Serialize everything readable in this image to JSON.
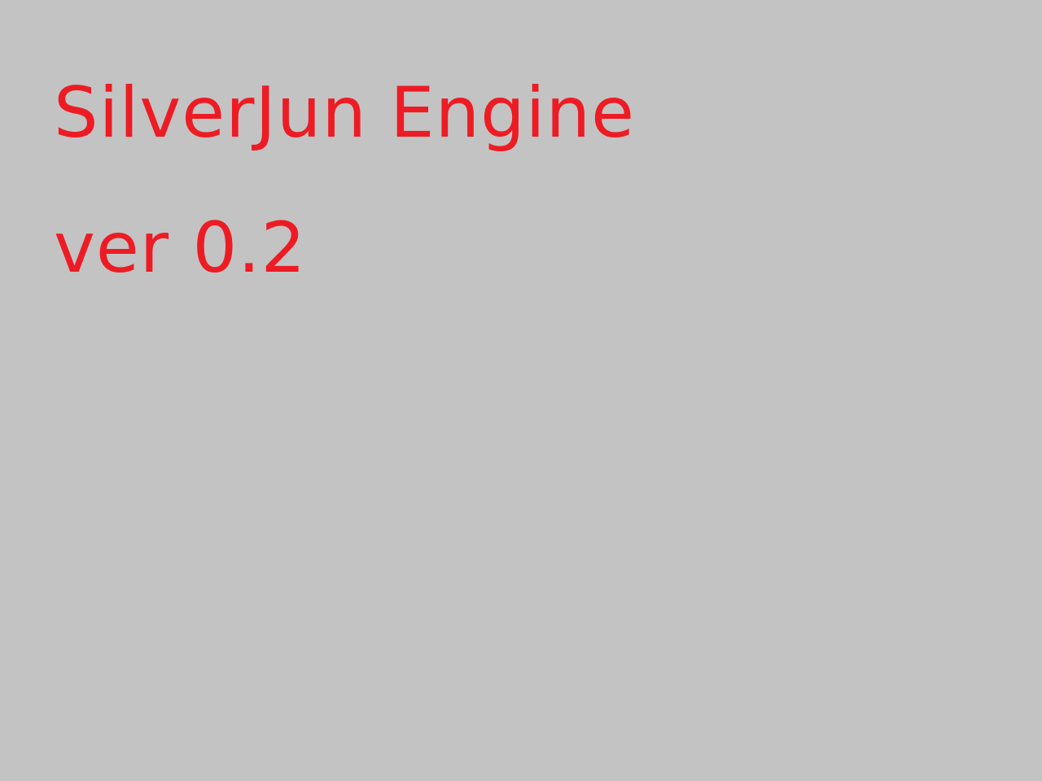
{
  "screen": {
    "background_color": "#c3c3c3",
    "text_color": "#ed1c24",
    "title": "SilverJun Engine",
    "version": "ver 0.2"
  }
}
